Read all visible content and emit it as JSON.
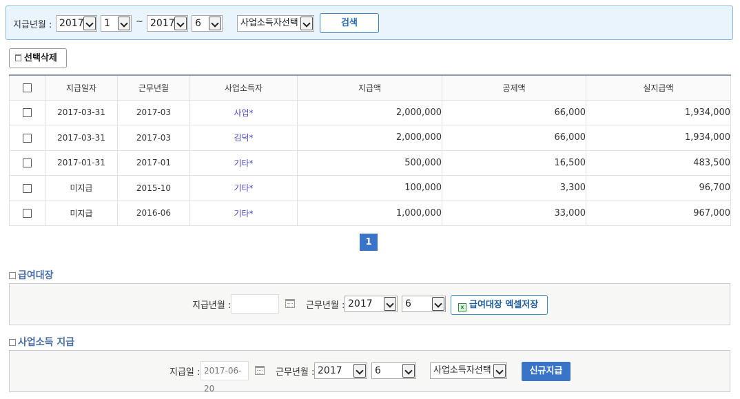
{
  "search": {
    "label": "지급년월 :",
    "from_year": "2017",
    "from_month": "1",
    "tilde": "~",
    "to_year": "2017",
    "to_month": "6",
    "earner_select": "사업소득자선택",
    "search_button": "검색"
  },
  "toolbar": {
    "delete_selected": "선택삭제"
  },
  "table": {
    "headers": [
      "지급일자",
      "근무년월",
      "사업소득자",
      "지급액",
      "공제액",
      "실지급액"
    ],
    "rows": [
      {
        "pay_date": "2017-03-31",
        "work_month": "2017-03",
        "earner": "사업*",
        "paid": "2,000,000",
        "deduction": "66,000",
        "net": "1,934,000"
      },
      {
        "pay_date": "2017-03-31",
        "work_month": "2017-03",
        "earner": "김덕*",
        "paid": "2,000,000",
        "deduction": "66,000",
        "net": "1,934,000"
      },
      {
        "pay_date": "2017-01-31",
        "work_month": "2017-01",
        "earner": "기타*",
        "paid": "500,000",
        "deduction": "16,500",
        "net": "483,500"
      },
      {
        "pay_date": "미지급",
        "work_month": "2015-10",
        "earner": "기타*",
        "paid": "100,000",
        "deduction": "3,300",
        "net": "96,700"
      },
      {
        "pay_date": "미지급",
        "work_month": "2016-06",
        "earner": "기타*",
        "paid": "1,000,000",
        "deduction": "33,000",
        "net": "967,000"
      }
    ]
  },
  "pagination": {
    "current": "1"
  },
  "payroll_ledger": {
    "title": "급여대장",
    "pay_month_label": "지급년월 :",
    "pay_month_value": "",
    "work_month_label": "근무년월 :",
    "work_year": "2017",
    "work_month": "6",
    "excel_button": "급여대장 엑셀저장"
  },
  "business_income_pay": {
    "title": "사업소득 지급",
    "pay_date_label": "지급일 :",
    "pay_date_value": "2017-06-20",
    "work_month_label": "근무년월 :",
    "work_year": "2017",
    "work_month": "6",
    "earner_select": "사업소득자선택",
    "new_pay_button": "신규지급"
  },
  "colors": {
    "accent": "#3a74c8",
    "search_panel_bg": "#e9f4fd",
    "link_text": "#4a4acf",
    "section_title": "#4a6fa5"
  }
}
